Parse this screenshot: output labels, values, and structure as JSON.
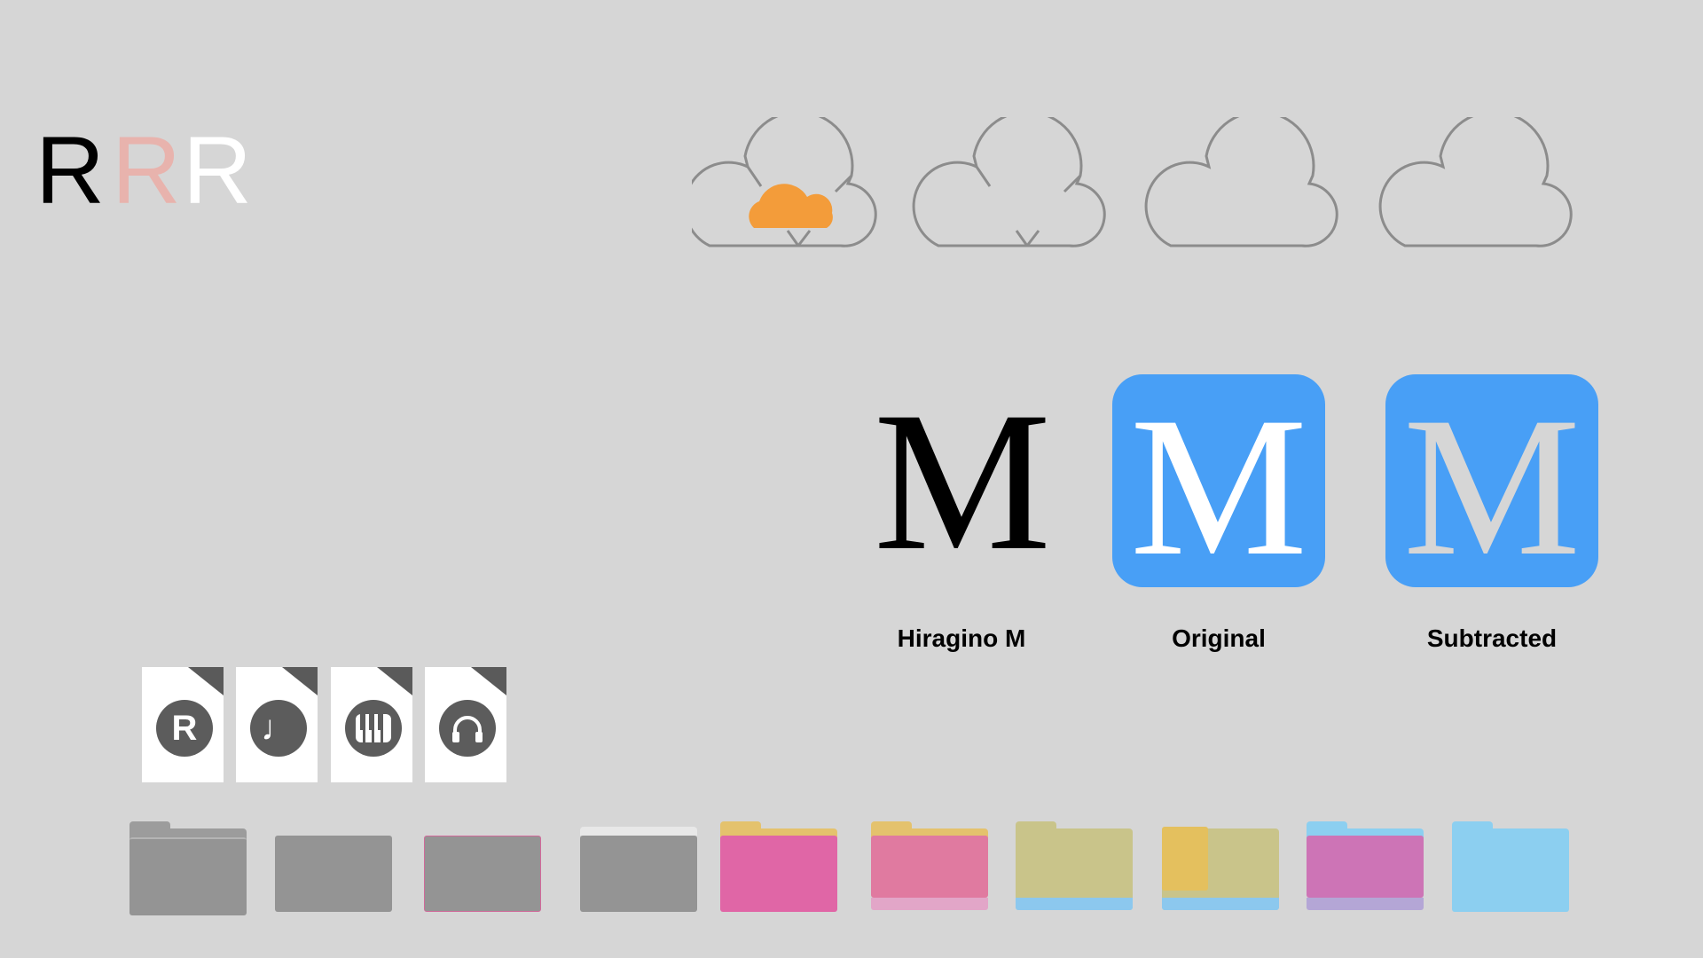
{
  "letters": {
    "r1": "R",
    "r2": "R",
    "r3": "R"
  },
  "clouds": [
    {
      "name": "cloud-download-orange",
      "fill": "#f39c3a"
    },
    {
      "name": "cloud-download-outline"
    },
    {
      "name": "cloud-outline"
    },
    {
      "name": "cloud-outline-plain"
    }
  ],
  "m_glyphs": {
    "plain": "M",
    "original": "M",
    "subtracted": "M",
    "tile_color": "#489ff6"
  },
  "captions": {
    "hiragino": "Hiragino M",
    "original": "Original",
    "subtracted": "Subtracted"
  },
  "documents": [
    {
      "icon": "r-document-icon",
      "glyph": "R"
    },
    {
      "icon": "music-note-icon",
      "glyph": "♩"
    },
    {
      "icon": "piano-keys-icon",
      "glyph": ""
    },
    {
      "icon": "headphones-icon",
      "glyph": ""
    }
  ],
  "folders": [
    {
      "name": "folder-gray-full"
    },
    {
      "name": "folder-gray-front"
    },
    {
      "name": "folder-gray-pink-outline"
    },
    {
      "name": "folder-gray-white-tab"
    },
    {
      "name": "folder-pink-yellow-tab"
    },
    {
      "name": "folder-pink-overlay"
    },
    {
      "name": "folder-khaki-blue-strip"
    },
    {
      "name": "folder-khaki-yellow-overlay"
    },
    {
      "name": "folder-magenta-blue"
    },
    {
      "name": "folder-blue"
    }
  ],
  "colors": {
    "background": "#d6d6d6",
    "accent_blue": "#489ff6",
    "accent_orange": "#f39c3a",
    "pink": "#e066a6",
    "folder_gray": "#949494"
  }
}
